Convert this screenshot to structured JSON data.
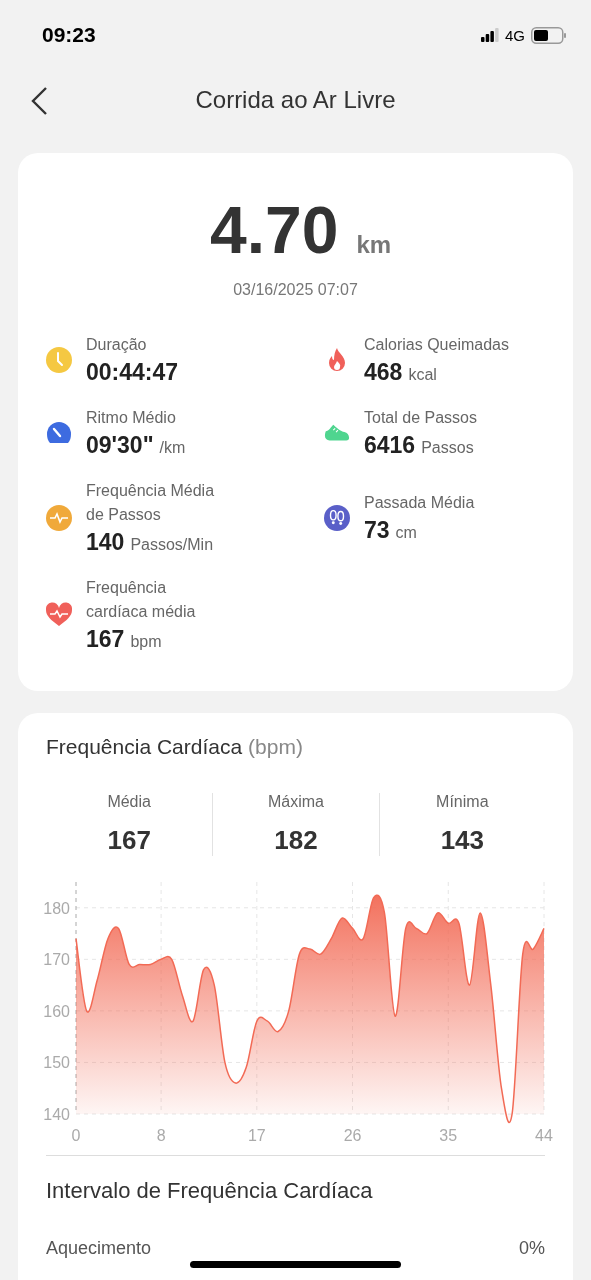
{
  "status_bar": {
    "time": "09:23",
    "network": "4G"
  },
  "header": {
    "title": "Corrida ao Ar Livre"
  },
  "summary": {
    "distance": "4.70",
    "unit": "km",
    "date": "03/16/2025 07:07",
    "metrics": [
      {
        "kind": "clock",
        "color": "#f5c842",
        "label": "Duração",
        "value": "00:44:47"
      },
      {
        "kind": "flame",
        "color": "#f0605a",
        "label": "Calorias Queimadas",
        "value": "468",
        "unit": "kcal"
      },
      {
        "kind": "gauge",
        "color": "#3d6be0",
        "label": "Ritmo Médio",
        "value": "09'30\"",
        "unit": "/km"
      },
      {
        "kind": "shoe",
        "color": "#4fd58f",
        "label": "Total de Passos",
        "value": "6416",
        "unit": "Passos"
      },
      {
        "kind": "wave",
        "color": "#f0a93a",
        "label": "Frequência Média de Passos",
        "value": "140",
        "unit": "Passos/Min"
      },
      {
        "kind": "footprints",
        "color": "#5a5fc8",
        "label": "Passada Média",
        "value": "73",
        "unit": "cm"
      },
      {
        "kind": "heart",
        "color": "#f0605a",
        "label": "Frequência cardíaca média",
        "value": "167",
        "unit": "bpm"
      }
    ]
  },
  "heart_rate": {
    "title": "Frequência Cardíaca",
    "unit": "(bpm)",
    "stats": [
      {
        "label": "Média",
        "value": "167"
      },
      {
        "label": "Máxima",
        "value": "182"
      },
      {
        "label": "Mínima",
        "value": "143"
      }
    ],
    "chart_data": {
      "type": "area",
      "x": [
        0,
        1,
        2,
        3,
        4,
        5,
        6,
        7,
        8,
        9,
        10,
        11,
        12,
        13,
        14,
        15,
        16,
        17,
        18,
        19,
        20,
        21,
        22,
        23,
        24,
        25,
        26,
        27,
        28,
        29,
        30,
        31,
        32,
        33,
        34,
        35,
        36,
        37,
        38,
        39,
        40,
        41,
        42,
        43,
        44
      ],
      "series": [
        {
          "color": "#f26a55",
          "values": [
            174,
            160,
            166,
            174,
            176,
            169,
            169,
            169,
            170,
            170,
            163,
            158,
            168,
            165,
            150,
            146,
            149,
            158,
            158,
            156,
            160,
            171,
            172,
            171,
            174,
            178,
            176,
            174,
            182,
            179,
            159,
            176,
            176,
            175,
            179,
            177,
            177,
            165,
            179,
            165,
            145,
            140,
            171,
            172,
            176
          ]
        }
      ],
      "xlim": [
        0,
        44
      ],
      "ylim": [
        140,
        185
      ],
      "xticks": [
        0,
        8,
        17,
        26,
        35,
        44
      ],
      "yticks": [
        140,
        150,
        160,
        170,
        180
      ],
      "grid": true
    }
  },
  "zones": {
    "title": "Intervalo de Frequência Cardíaca",
    "rows": [
      {
        "label": "Aquecimento",
        "value": "0%"
      }
    ]
  }
}
